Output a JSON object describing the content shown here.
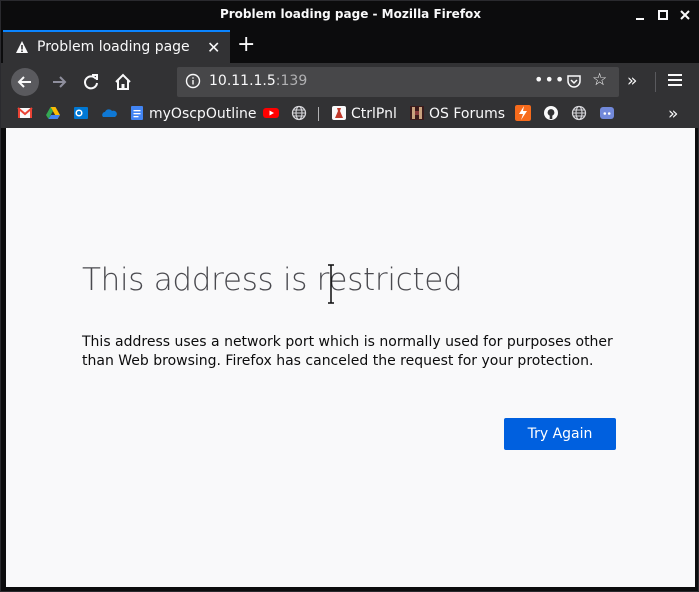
{
  "window": {
    "title": "Problem loading page - Mozilla Firefox"
  },
  "tab": {
    "title": "Problem loading page",
    "close_glyph": "✕",
    "new_tab_glyph": "+",
    "icon": "warning-icon"
  },
  "navbar": {
    "url_host": "10.11.1.5",
    "url_port": ":139",
    "more_glyph": "•••",
    "star_glyph": "☆",
    "overflow_glyph": "»"
  },
  "bookmarks": [
    {
      "label": "",
      "icon": "gmail-icon",
      "color": "#ea4335"
    },
    {
      "label": "",
      "icon": "google-drive-icon",
      "color": "#34a853"
    },
    {
      "label": "",
      "icon": "outlook-icon",
      "color": "#0078d4"
    },
    {
      "label": "",
      "icon": "onedrive-icon",
      "color": "#0f78d4"
    },
    {
      "label": "myOscpOutline",
      "icon": "google-docs-icon",
      "color": "#4285f4"
    },
    {
      "label": "",
      "icon": "youtube-icon",
      "color": "#ff0000"
    },
    {
      "label": "",
      "icon": "globe-icon",
      "color": "#d7d7db"
    },
    {
      "label": "CtrlPnl",
      "icon": "ctrlpnl-icon",
      "color": "#c0392b"
    },
    {
      "label": "OS Forums",
      "icon": "os-forums-icon",
      "color": "#5a2c2c"
    },
    {
      "label": "",
      "icon": "lightning-icon",
      "color": "#f76b1c"
    },
    {
      "label": "",
      "icon": "github-icon",
      "color": "#f9f9fa"
    },
    {
      "label": "",
      "icon": "globe-icon",
      "color": "#d7d7db"
    },
    {
      "label": "",
      "icon": "discord-icon",
      "color": "#7289da"
    }
  ],
  "bookmarks_overflow": "»",
  "error": {
    "title": "This address is restricted",
    "description": "This address uses a network port which is normally used for purposes other than Web browsing. Firefox has canceled the request for your protection.",
    "button": "Try Again"
  },
  "colors": {
    "accent": "#0a84ff",
    "button": "#0060df",
    "toolbar": "#323234",
    "titlebar": "#0c0c0d"
  }
}
